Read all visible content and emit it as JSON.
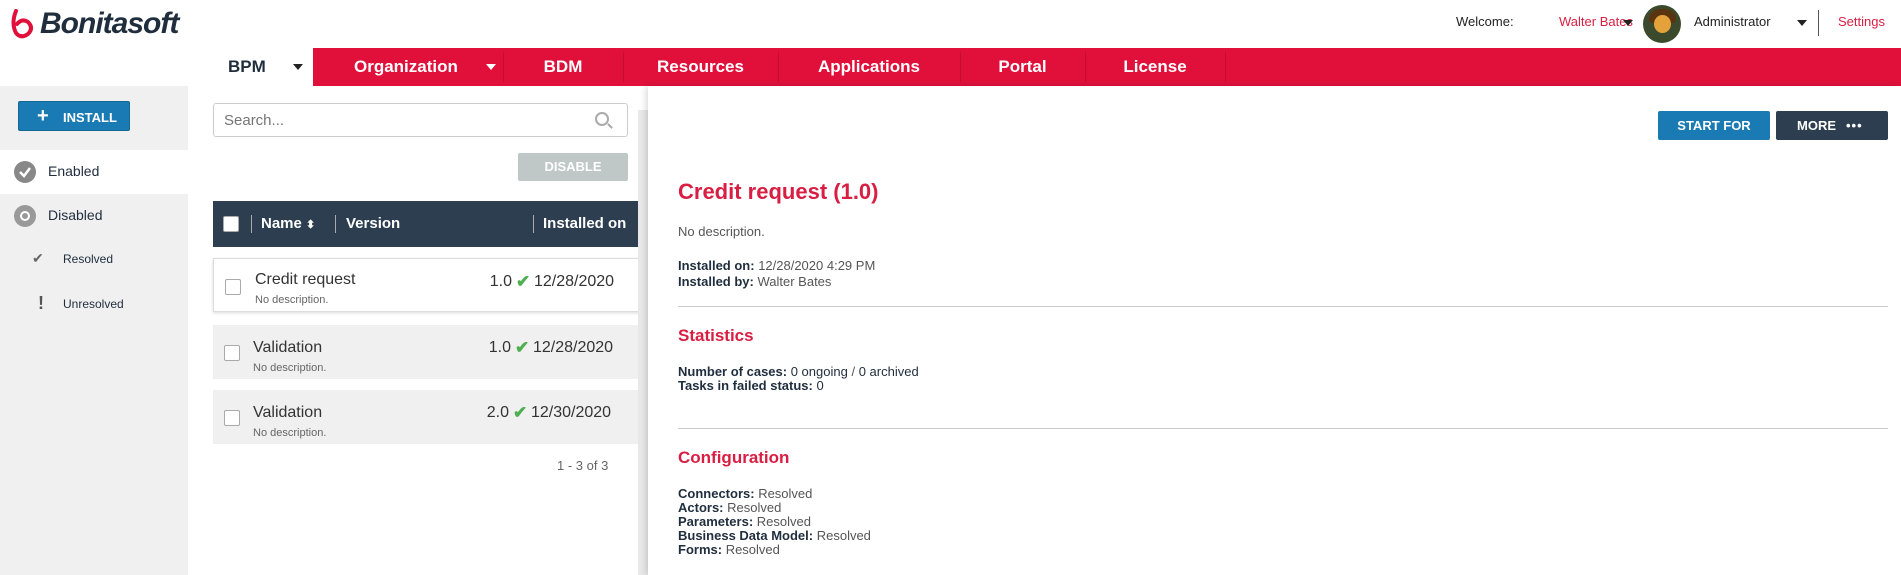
{
  "header": {
    "logo_text": "Bonitasoft",
    "welcome_label": "Welcome:",
    "user_name": "Walter Bates",
    "role": "Administrator",
    "settings_label": "Settings"
  },
  "nav": {
    "items": [
      {
        "label": "BPM"
      },
      {
        "label": "Organization"
      },
      {
        "label": "BDM"
      },
      {
        "label": "Resources"
      },
      {
        "label": "Applications"
      },
      {
        "label": "Portal"
      },
      {
        "label": "License"
      }
    ]
  },
  "sidebar": {
    "install_label": "INSTALL",
    "items": [
      {
        "label": "Enabled"
      },
      {
        "label": "Disabled"
      },
      {
        "label": "Resolved"
      },
      {
        "label": "Unresolved"
      }
    ]
  },
  "list": {
    "search_placeholder": "Search...",
    "disable_label": "DISABLE",
    "columns": {
      "name": "Name",
      "version": "Version",
      "installed_on": "Installed on"
    },
    "rows": [
      {
        "name": "Credit request",
        "description": "No description.",
        "version": "1.0",
        "installed_on": "12/28/2020"
      },
      {
        "name": "Validation",
        "description": "No description.",
        "version": "1.0",
        "installed_on": "12/28/2020"
      },
      {
        "name": "Validation",
        "description": "No description.",
        "version": "2.0",
        "installed_on": "12/30/2020"
      }
    ],
    "pager": "1 - 3 of 3"
  },
  "detail": {
    "start_for_label": "START FOR",
    "more_label": "MORE",
    "title": "Credit request (1.0)",
    "description": "No description.",
    "installed_on_label": "Installed on:",
    "installed_on_value": "12/28/2020 4:29 PM",
    "installed_by_label": "Installed by:",
    "installed_by_value": "Walter Bates",
    "statistics_title": "Statistics",
    "cases_label": "Number of cases:",
    "cases_ongoing": "0 ongoing",
    "cases_sep": "/",
    "cases_archived": "0 archived",
    "failed_label": "Tasks in failed status:",
    "failed_value": "0",
    "configuration_title": "Configuration",
    "config": [
      {
        "label": "Connectors:",
        "value": "Resolved"
      },
      {
        "label": "Actors:",
        "value": "Resolved"
      },
      {
        "label": "Parameters:",
        "value": "Resolved"
      },
      {
        "label": "Business Data Model:",
        "value": "Resolved"
      },
      {
        "label": "Forms:",
        "value": "Resolved"
      }
    ]
  },
  "colors": {
    "brand_red": "#e0103a",
    "accent_blue": "#1a7ab3",
    "dark_navy": "#2c3e50"
  }
}
